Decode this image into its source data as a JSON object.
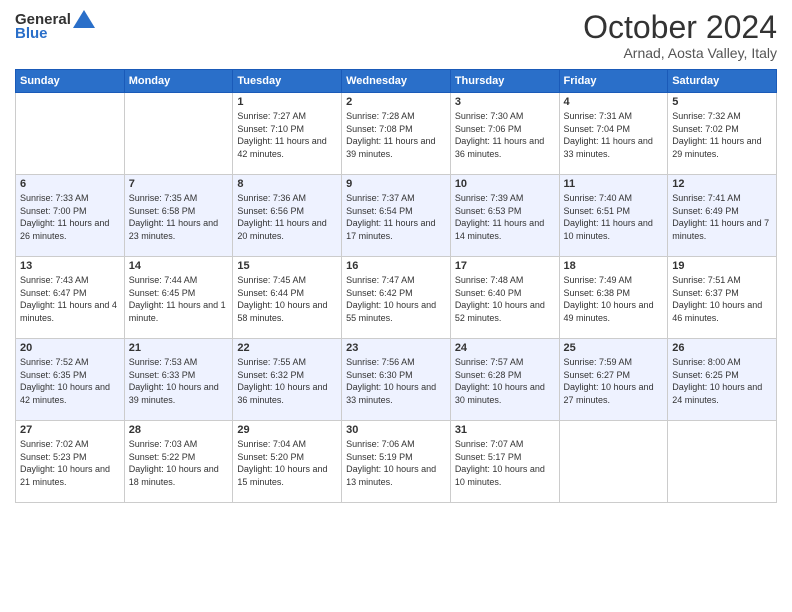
{
  "logo": {
    "general": "General",
    "blue": "Blue"
  },
  "header": {
    "month": "October 2024",
    "location": "Arnad, Aosta Valley, Italy"
  },
  "days_of_week": [
    "Sunday",
    "Monday",
    "Tuesday",
    "Wednesday",
    "Thursday",
    "Friday",
    "Saturday"
  ],
  "weeks": [
    [
      {
        "day": "",
        "sunrise": "",
        "sunset": "",
        "daylight": ""
      },
      {
        "day": "",
        "sunrise": "",
        "sunset": "",
        "daylight": ""
      },
      {
        "day": "1",
        "sunrise": "Sunrise: 7:27 AM",
        "sunset": "Sunset: 7:10 PM",
        "daylight": "Daylight: 11 hours and 42 minutes."
      },
      {
        "day": "2",
        "sunrise": "Sunrise: 7:28 AM",
        "sunset": "Sunset: 7:08 PM",
        "daylight": "Daylight: 11 hours and 39 minutes."
      },
      {
        "day": "3",
        "sunrise": "Sunrise: 7:30 AM",
        "sunset": "Sunset: 7:06 PM",
        "daylight": "Daylight: 11 hours and 36 minutes."
      },
      {
        "day": "4",
        "sunrise": "Sunrise: 7:31 AM",
        "sunset": "Sunset: 7:04 PM",
        "daylight": "Daylight: 11 hours and 33 minutes."
      },
      {
        "day": "5",
        "sunrise": "Sunrise: 7:32 AM",
        "sunset": "Sunset: 7:02 PM",
        "daylight": "Daylight: 11 hours and 29 minutes."
      }
    ],
    [
      {
        "day": "6",
        "sunrise": "Sunrise: 7:33 AM",
        "sunset": "Sunset: 7:00 PM",
        "daylight": "Daylight: 11 hours and 26 minutes."
      },
      {
        "day": "7",
        "sunrise": "Sunrise: 7:35 AM",
        "sunset": "Sunset: 6:58 PM",
        "daylight": "Daylight: 11 hours and 23 minutes."
      },
      {
        "day": "8",
        "sunrise": "Sunrise: 7:36 AM",
        "sunset": "Sunset: 6:56 PM",
        "daylight": "Daylight: 11 hours and 20 minutes."
      },
      {
        "day": "9",
        "sunrise": "Sunrise: 7:37 AM",
        "sunset": "Sunset: 6:54 PM",
        "daylight": "Daylight: 11 hours and 17 minutes."
      },
      {
        "day": "10",
        "sunrise": "Sunrise: 7:39 AM",
        "sunset": "Sunset: 6:53 PM",
        "daylight": "Daylight: 11 hours and 14 minutes."
      },
      {
        "day": "11",
        "sunrise": "Sunrise: 7:40 AM",
        "sunset": "Sunset: 6:51 PM",
        "daylight": "Daylight: 11 hours and 10 minutes."
      },
      {
        "day": "12",
        "sunrise": "Sunrise: 7:41 AM",
        "sunset": "Sunset: 6:49 PM",
        "daylight": "Daylight: 11 hours and 7 minutes."
      }
    ],
    [
      {
        "day": "13",
        "sunrise": "Sunrise: 7:43 AM",
        "sunset": "Sunset: 6:47 PM",
        "daylight": "Daylight: 11 hours and 4 minutes."
      },
      {
        "day": "14",
        "sunrise": "Sunrise: 7:44 AM",
        "sunset": "Sunset: 6:45 PM",
        "daylight": "Daylight: 11 hours and 1 minute."
      },
      {
        "day": "15",
        "sunrise": "Sunrise: 7:45 AM",
        "sunset": "Sunset: 6:44 PM",
        "daylight": "Daylight: 10 hours and 58 minutes."
      },
      {
        "day": "16",
        "sunrise": "Sunrise: 7:47 AM",
        "sunset": "Sunset: 6:42 PM",
        "daylight": "Daylight: 10 hours and 55 minutes."
      },
      {
        "day": "17",
        "sunrise": "Sunrise: 7:48 AM",
        "sunset": "Sunset: 6:40 PM",
        "daylight": "Daylight: 10 hours and 52 minutes."
      },
      {
        "day": "18",
        "sunrise": "Sunrise: 7:49 AM",
        "sunset": "Sunset: 6:38 PM",
        "daylight": "Daylight: 10 hours and 49 minutes."
      },
      {
        "day": "19",
        "sunrise": "Sunrise: 7:51 AM",
        "sunset": "Sunset: 6:37 PM",
        "daylight": "Daylight: 10 hours and 46 minutes."
      }
    ],
    [
      {
        "day": "20",
        "sunrise": "Sunrise: 7:52 AM",
        "sunset": "Sunset: 6:35 PM",
        "daylight": "Daylight: 10 hours and 42 minutes."
      },
      {
        "day": "21",
        "sunrise": "Sunrise: 7:53 AM",
        "sunset": "Sunset: 6:33 PM",
        "daylight": "Daylight: 10 hours and 39 minutes."
      },
      {
        "day": "22",
        "sunrise": "Sunrise: 7:55 AM",
        "sunset": "Sunset: 6:32 PM",
        "daylight": "Daylight: 10 hours and 36 minutes."
      },
      {
        "day": "23",
        "sunrise": "Sunrise: 7:56 AM",
        "sunset": "Sunset: 6:30 PM",
        "daylight": "Daylight: 10 hours and 33 minutes."
      },
      {
        "day": "24",
        "sunrise": "Sunrise: 7:57 AM",
        "sunset": "Sunset: 6:28 PM",
        "daylight": "Daylight: 10 hours and 30 minutes."
      },
      {
        "day": "25",
        "sunrise": "Sunrise: 7:59 AM",
        "sunset": "Sunset: 6:27 PM",
        "daylight": "Daylight: 10 hours and 27 minutes."
      },
      {
        "day": "26",
        "sunrise": "Sunrise: 8:00 AM",
        "sunset": "Sunset: 6:25 PM",
        "daylight": "Daylight: 10 hours and 24 minutes."
      }
    ],
    [
      {
        "day": "27",
        "sunrise": "Sunrise: 7:02 AM",
        "sunset": "Sunset: 5:23 PM",
        "daylight": "Daylight: 10 hours and 21 minutes."
      },
      {
        "day": "28",
        "sunrise": "Sunrise: 7:03 AM",
        "sunset": "Sunset: 5:22 PM",
        "daylight": "Daylight: 10 hours and 18 minutes."
      },
      {
        "day": "29",
        "sunrise": "Sunrise: 7:04 AM",
        "sunset": "Sunset: 5:20 PM",
        "daylight": "Daylight: 10 hours and 15 minutes."
      },
      {
        "day": "30",
        "sunrise": "Sunrise: 7:06 AM",
        "sunset": "Sunset: 5:19 PM",
        "daylight": "Daylight: 10 hours and 13 minutes."
      },
      {
        "day": "31",
        "sunrise": "Sunrise: 7:07 AM",
        "sunset": "Sunset: 5:17 PM",
        "daylight": "Daylight: 10 hours and 10 minutes."
      },
      {
        "day": "",
        "sunrise": "",
        "sunset": "",
        "daylight": ""
      },
      {
        "day": "",
        "sunrise": "",
        "sunset": "",
        "daylight": ""
      }
    ]
  ]
}
